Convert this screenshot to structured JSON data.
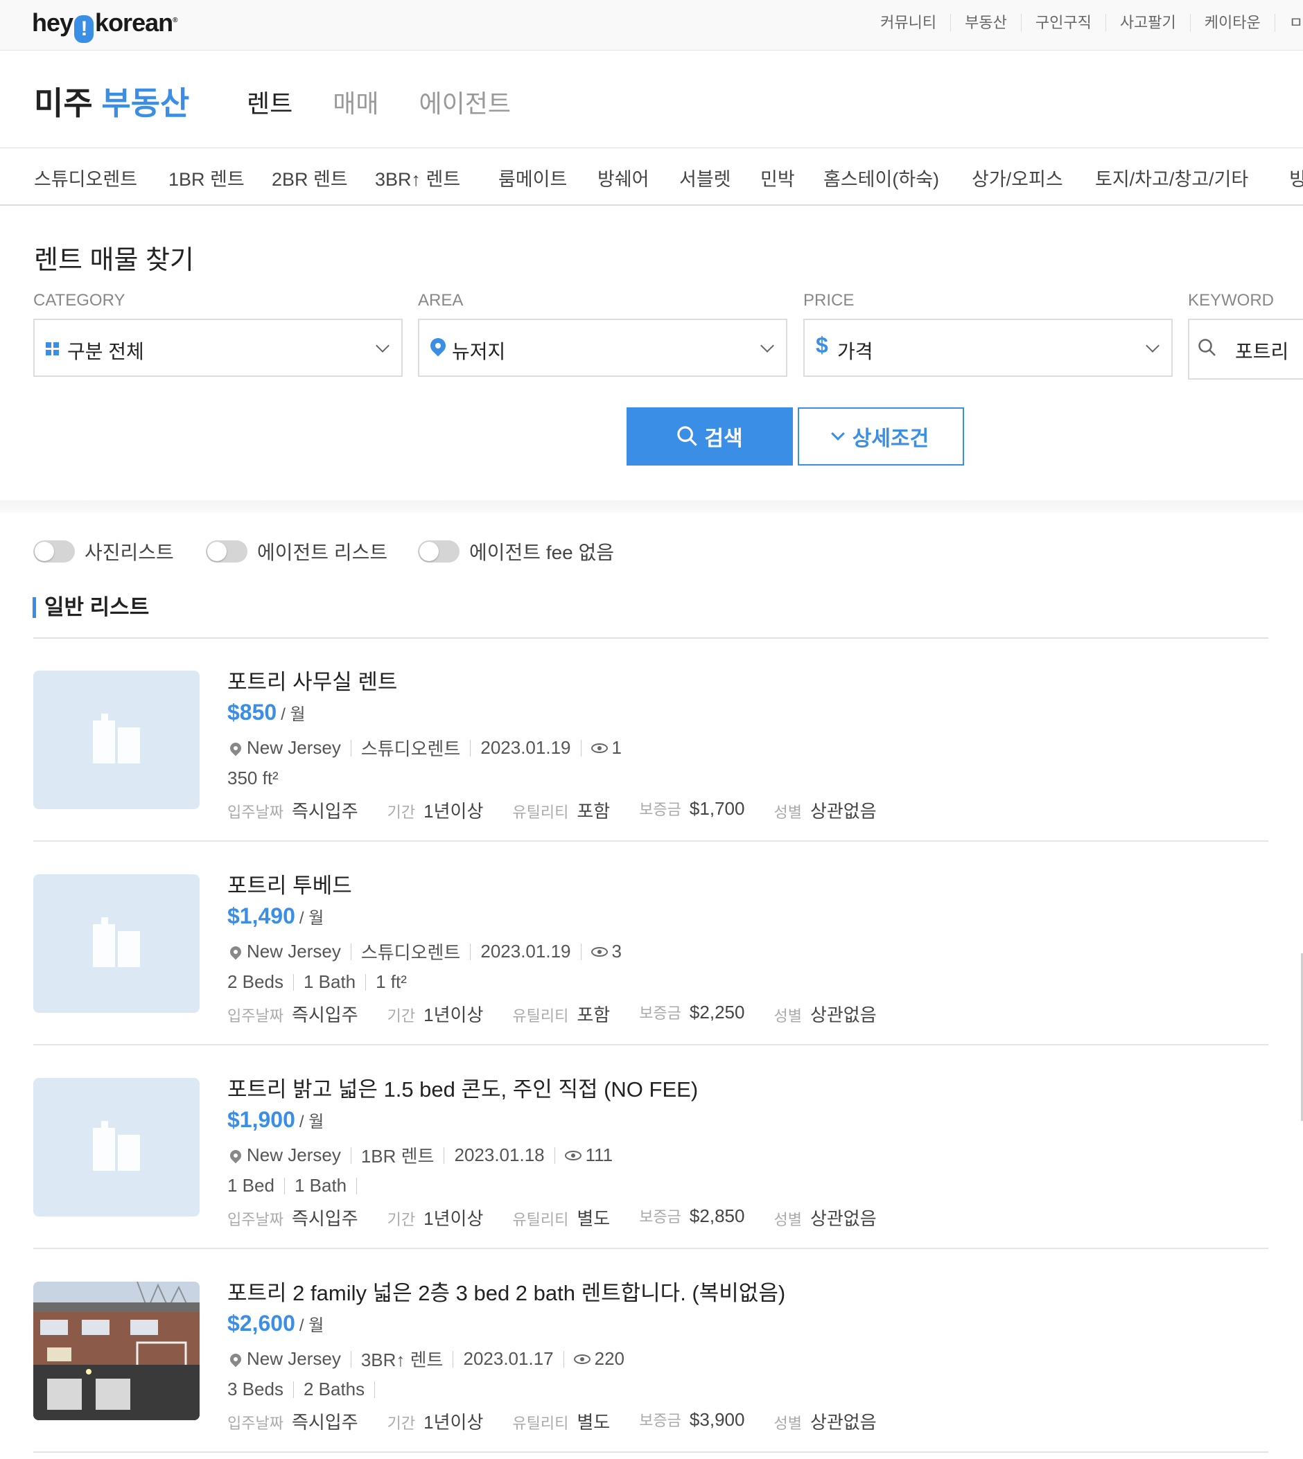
{
  "topbar": {
    "logo": {
      "pre": "hey",
      "mark": "!",
      "post": "korean",
      "reg": "®"
    },
    "nav": [
      "커뮤니티",
      "부동산",
      "구인구직",
      "사고팔기",
      "케이타운",
      "ㅁ"
    ]
  },
  "header": {
    "brand_plain": "미주",
    "brand_accent": "부동산",
    "tabs": [
      "렌트",
      "매매",
      "에이전트"
    ],
    "active_tab": "렌트"
  },
  "categories": [
    "스튜디오렌트",
    "1BR 렌트",
    "2BR 렌트",
    "3BR↑ 렌트",
    "룸메이트",
    "방쉐어",
    "서블렛",
    "민박",
    "홈스테이(하숙)",
    "상가/오피스",
    "토지/차고/창고/기타",
    "빙"
  ],
  "search": {
    "title": "렌트 매물 찾기",
    "category": {
      "label": "CATEGORY",
      "value": "구분 전체"
    },
    "area": {
      "label": "AREA",
      "value": "뉴저지"
    },
    "price": {
      "label": "PRICE",
      "value": "가격"
    },
    "keyword": {
      "label": "KEYWORD",
      "value": "포트리"
    },
    "search_button": "검색",
    "detail_button": "상세조건"
  },
  "toggles": [
    "사진리스트",
    "에이전트 리스트",
    "에이전트 fee 없음"
  ],
  "list_title": "일반 리스트",
  "listings": [
    {
      "title": "포트리 사무실 렌트",
      "price": "$850",
      "per": "/ 월",
      "location": "New Jersey",
      "type": "스튜디오렌트",
      "date": "2023.01.19",
      "views": "1",
      "specs": [
        "350 ft²"
      ],
      "move_in_k": "입주날짜",
      "move_in_v": "즉시입주",
      "term_k": "기간",
      "term_v": "1년이상",
      "util_k": "유틸리티",
      "util_v": "포함",
      "deposit_k": "보증금",
      "deposit_v": "$1,700",
      "gender_k": "성별",
      "gender_v": "상관없음"
    },
    {
      "title": "포트리 투베드",
      "price": "$1,490",
      "per": "/ 월",
      "location": "New Jersey",
      "type": "스튜디오렌트",
      "date": "2023.01.19",
      "views": "3",
      "specs": [
        "2 Beds",
        "1 Bath",
        "1 ft²"
      ],
      "move_in_k": "입주날짜",
      "move_in_v": "즉시입주",
      "term_k": "기간",
      "term_v": "1년이상",
      "util_k": "유틸리티",
      "util_v": "포함",
      "deposit_k": "보증금",
      "deposit_v": "$2,250",
      "gender_k": "성별",
      "gender_v": "상관없음"
    },
    {
      "title": "포트리 밝고 넓은 1.5 bed 콘도, 주인 직접 (NO FEE)",
      "price": "$1,900",
      "per": "/ 월",
      "location": "New Jersey",
      "type": "1BR 렌트",
      "date": "2023.01.18",
      "views": "111",
      "specs": [
        "1 Bed",
        "1 Bath"
      ],
      "move_in_k": "입주날짜",
      "move_in_v": "즉시입주",
      "term_k": "기간",
      "term_v": "1년이상",
      "util_k": "유틸리티",
      "util_v": "별도",
      "deposit_k": "보증금",
      "deposit_v": "$2,850",
      "gender_k": "성별",
      "gender_v": "상관없음"
    },
    {
      "title": "포트리 2 family 넓은 2층 3 bed 2 bath 렌트합니다. (복비없음)",
      "price": "$2,600",
      "per": "/ 월",
      "location": "New Jersey",
      "type": "3BR↑ 렌트",
      "date": "2023.01.17",
      "views": "220",
      "specs": [
        "3 Beds",
        "2 Baths"
      ],
      "move_in_k": "입주날짜",
      "move_in_v": "즉시입주",
      "term_k": "기간",
      "term_v": "1년이상",
      "util_k": "유틸리티",
      "util_v": "별도",
      "deposit_k": "보증금",
      "deposit_v": "$3,900",
      "gender_k": "성별",
      "gender_v": "상관없음"
    }
  ],
  "colors": {
    "accent": "#3a8ee6",
    "thumb_placeholder": "#dde8f5"
  }
}
